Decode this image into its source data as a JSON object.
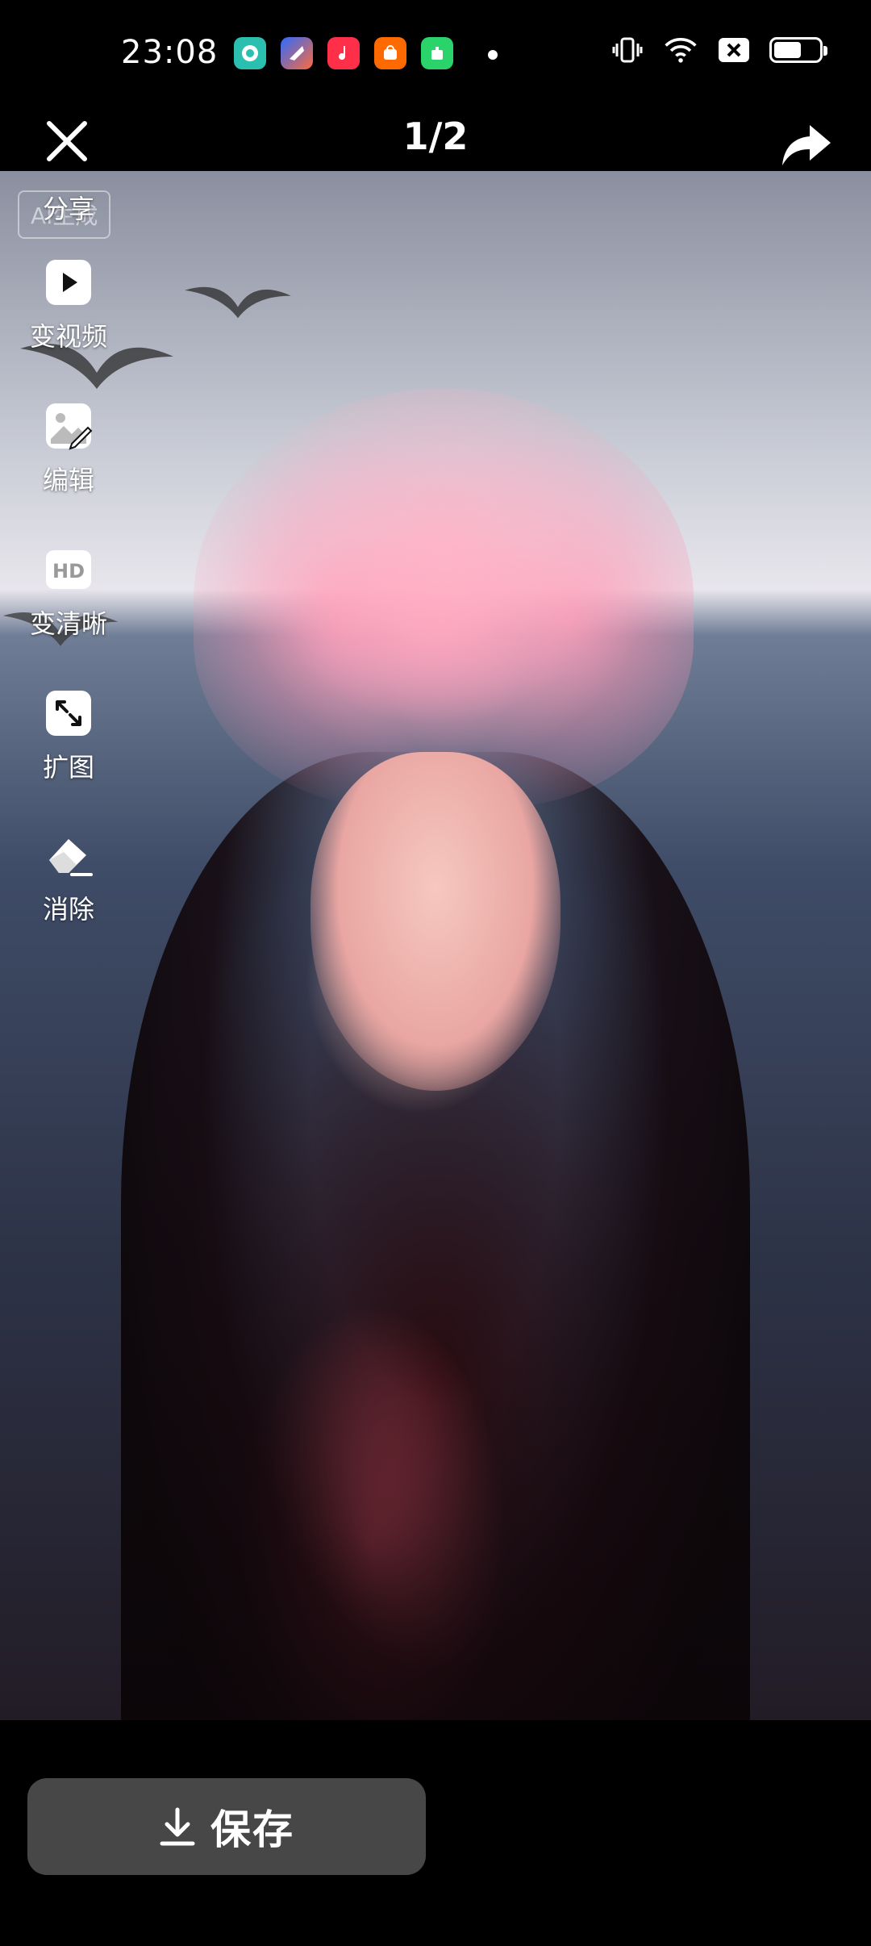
{
  "status_bar": {
    "time": "23:08",
    "app_icons": [
      "messenger-icon",
      "shortcut-icon",
      "music-icon",
      "shopping-icon",
      "store-icon"
    ],
    "system_icons": [
      "vibrate-icon",
      "wifi-icon",
      "sim-off-icon",
      "battery-icon"
    ],
    "battery_level": 0.55
  },
  "viewer": {
    "page_counter": "1/2",
    "ai_badge": "AI生成"
  },
  "tools": [
    {
      "name": "share",
      "label": "分享"
    },
    {
      "name": "to-video",
      "label": "变视频"
    },
    {
      "name": "edit",
      "label": "编辑"
    },
    {
      "name": "enhance",
      "label": "变清晰",
      "icon_text": "HD"
    },
    {
      "name": "expand",
      "label": "扩图"
    },
    {
      "name": "erase",
      "label": "消除"
    }
  ],
  "footer": {
    "save_label": "保存"
  },
  "colors": {
    "background": "#000000",
    "save_button": "#474747",
    "icon_fill": "#ffffff"
  }
}
